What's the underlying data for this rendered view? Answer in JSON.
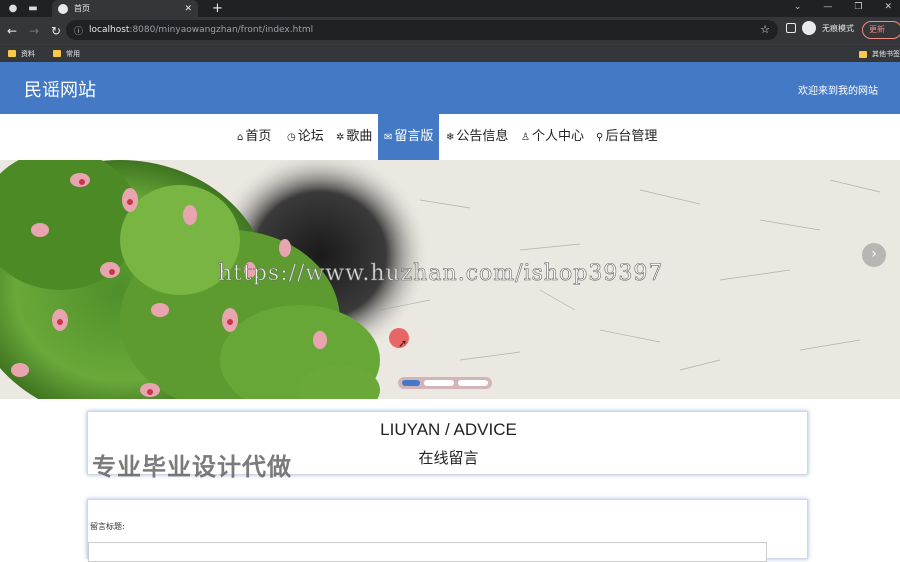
{
  "browser": {
    "tab_title": "首页",
    "url_host": "localhost",
    "url_rest": ":8080/minyaowangzhan/front/index.html",
    "profile_label": "无痕模式",
    "update_label": "更新",
    "bookmarks": [
      "资料",
      "常用"
    ],
    "other_bookmarks": "其他书签"
  },
  "site": {
    "title": "民谣网站",
    "welcome": "欢迎来到我的网站"
  },
  "nav": {
    "items": [
      {
        "icon": "⌂",
        "label": "首页"
      },
      {
        "icon": "◷",
        "label": "论坛"
      },
      {
        "icon": "✲",
        "label": "歌曲"
      },
      {
        "icon": "✉",
        "label": "留言版"
      },
      {
        "icon": "❄",
        "label": "公告信息"
      },
      {
        "icon": "♙",
        "label": "个人中心"
      },
      {
        "icon": "⚲",
        "label": "后台管理"
      }
    ],
    "active_index": 3
  },
  "banner": {
    "watermark": "https://www.huzhan.com/ishop39397",
    "slide_count": 3,
    "active_slide": 0
  },
  "section": {
    "title_en": "LIUYAN / ADVICE",
    "title_zh": "在线留言",
    "overlay": "专业毕业设计代做"
  },
  "form": {
    "title_label": "留言标题:"
  },
  "colors": {
    "primary": "#4479c5",
    "chrome_dark": "#202124",
    "chrome_mid": "#35363a"
  }
}
